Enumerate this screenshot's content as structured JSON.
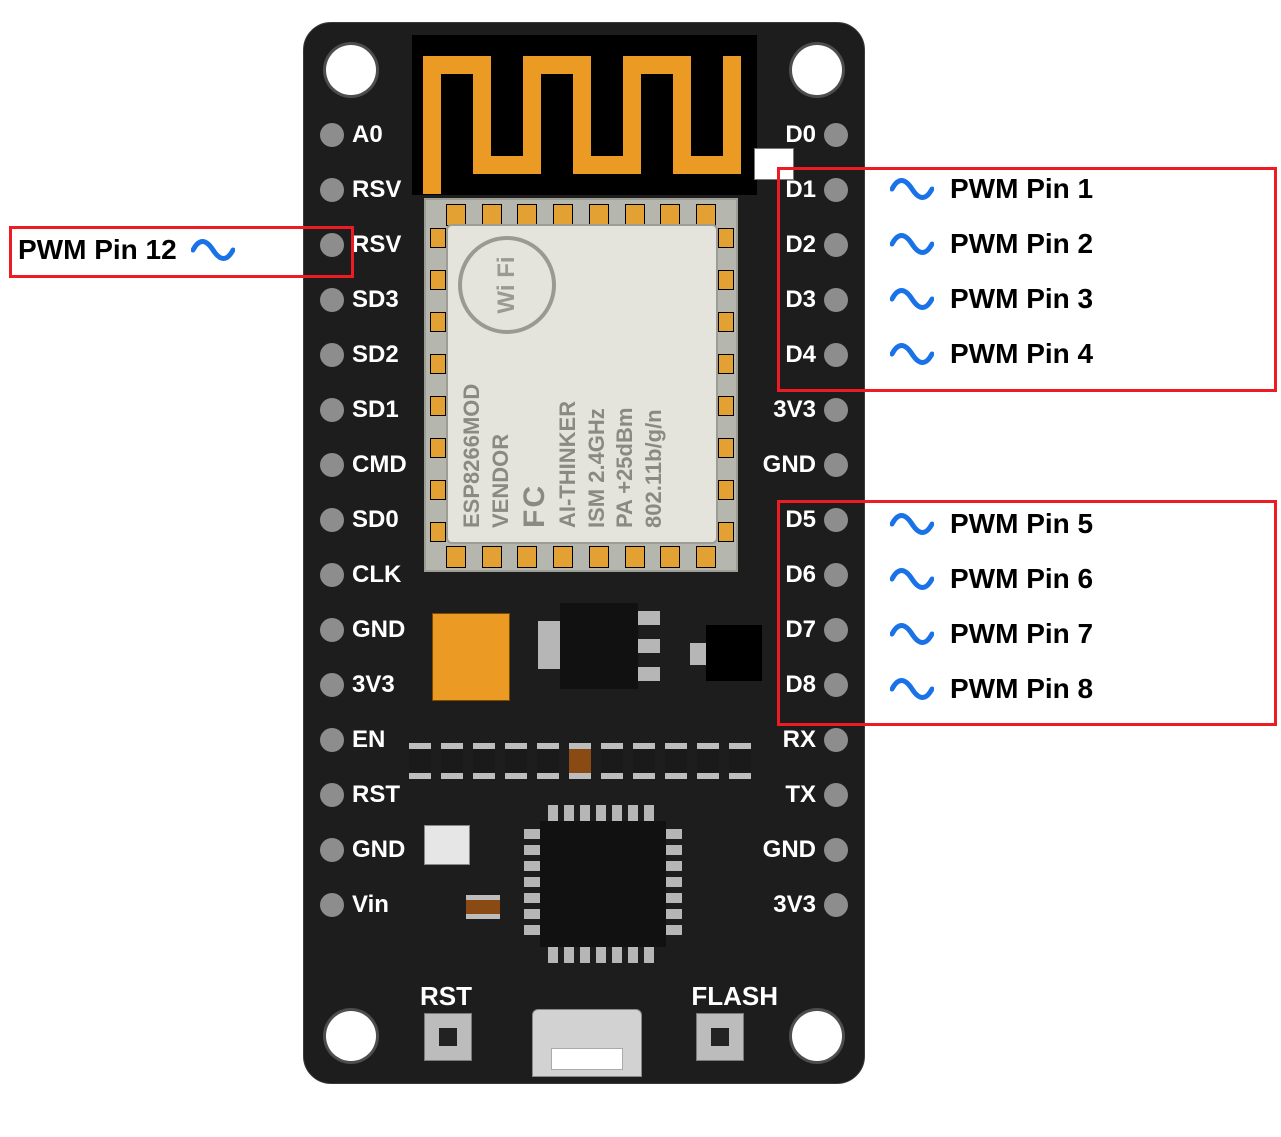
{
  "board": {
    "left_pins": [
      "A0",
      "RSV",
      "RSV",
      "SD3",
      "SD2",
      "SD1",
      "CMD",
      "SD0",
      "CLK",
      "GND",
      "3V3",
      "EN",
      "RST",
      "GND",
      "Vin"
    ],
    "right_pins": [
      "D0",
      "D1",
      "D2",
      "D3",
      "D4",
      "3V3",
      "GND",
      "D5",
      "D6",
      "D7",
      "D8",
      "RX",
      "TX",
      "GND",
      "3V3"
    ],
    "buttons": {
      "rst": "RST",
      "flash": "FLASH"
    },
    "chip": {
      "model": "ESP8266MOD",
      "vendor": "VENDOR",
      "thinker": "AI-THINKER",
      "ism": "ISM 2.4GHz",
      "pa": "PA +25dBm",
      "std": "802.11b/g/n",
      "wifi": "Wi Fi",
      "fcc": "FC"
    }
  },
  "annotations": {
    "left": {
      "label": "PWM Pin 12"
    },
    "right_top": [
      {
        "label": "PWM Pin 1"
      },
      {
        "label": "PWM Pin 2"
      },
      {
        "label": "PWM Pin 3"
      },
      {
        "label": "PWM Pin 4"
      }
    ],
    "right_bottom": [
      {
        "label": "PWM Pin 5"
      },
      {
        "label": "PWM Pin 6"
      },
      {
        "label": "PWM Pin 7"
      },
      {
        "label": "PWM Pin 8"
      }
    ]
  }
}
